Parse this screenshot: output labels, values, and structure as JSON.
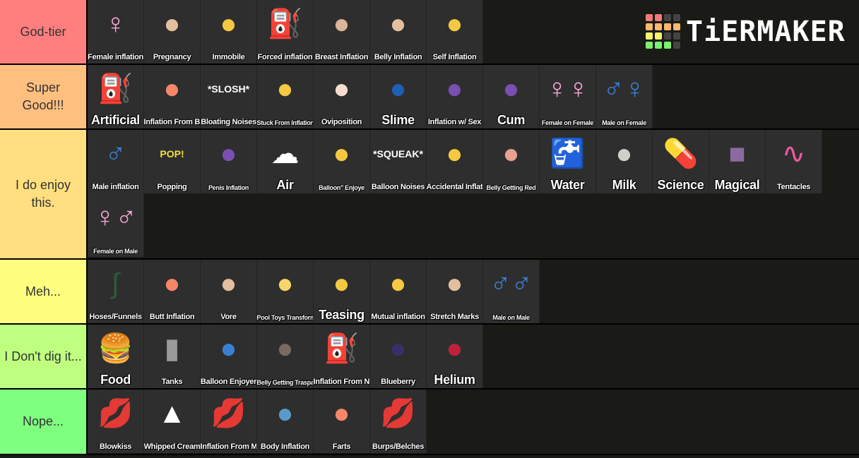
{
  "logo": {
    "text": "TiERMAKER",
    "grid_colors": [
      "#f27a7a",
      "#f27a7a",
      "#444444",
      "#444444",
      "#fdb96f",
      "#fdb96f",
      "#fdb96f",
      "#fdb96f",
      "#f7f26c",
      "#f7f26c",
      "#444444",
      "#444444",
      "#7cf06f",
      "#7cf06f",
      "#7cf06f",
      "#444444"
    ]
  },
  "tiers": [
    {
      "label": "God-tier",
      "color": "#ff7f7f",
      "items": [
        {
          "caption": "Female inflation",
          "icon": "female-symbol-icon",
          "glyph": "♀",
          "glyph_color": "#f7a6d8"
        },
        {
          "caption": "Pregnancy",
          "icon": "belly-icon",
          "glyph": "●",
          "glyph_color": "#e3bfa0"
        },
        {
          "caption": "Immobile",
          "icon": "face-emoji-icon",
          "glyph": "●",
          "glyph_color": "#f5c842"
        },
        {
          "caption": "Forced inflation",
          "icon": "pump-icon",
          "glyph": "⛽",
          "glyph_color": "#4a1010"
        },
        {
          "caption": "Breast Inflation",
          "icon": "breast-icon",
          "glyph": "●",
          "glyph_color": "#d9b59a"
        },
        {
          "caption": "Belly Inflation",
          "icon": "belly-icon",
          "glyph": "●",
          "glyph_color": "#e3bfa0"
        },
        {
          "caption": "Self Inflation",
          "icon": "face-emoji-icon",
          "glyph": "●",
          "glyph_color": "#f5c842"
        }
      ]
    },
    {
      "label": "Super Good!!!",
      "color": "#ffbf7f",
      "items": [
        {
          "caption": "Artificial",
          "icon": "pump-icon",
          "glyph": "⛽",
          "glyph_color": "#4a1010",
          "size": "big"
        },
        {
          "caption": "Inflation From Butt",
          "icon": "peach-icon",
          "glyph": "●",
          "glyph_color": "#f4876a"
        },
        {
          "caption": "Bloating Noises",
          "icon": "sound-text-icon",
          "glyph": "*SLOSH*",
          "glyph_color": "#ffffff"
        },
        {
          "caption": "Stuck From Inflation",
          "icon": "face-emoji-icon",
          "glyph": "●",
          "glyph_color": "#f5c842",
          "size": "small"
        },
        {
          "caption": "Oviposition",
          "icon": "egg-icon",
          "glyph": "●",
          "glyph_color": "#f7ddd0"
        },
        {
          "caption": "Slime",
          "icon": "slime-icon",
          "glyph": "●",
          "glyph_color": "#1e5fb3",
          "size": "big"
        },
        {
          "caption": "Inflation w/ Sex",
          "icon": "eggplant-icon",
          "glyph": "●",
          "glyph_color": "#7b4fb0"
        },
        {
          "caption": "Cum",
          "icon": "eggplant-icon",
          "glyph": "●",
          "glyph_color": "#7b4fb0",
          "size": "big"
        },
        {
          "caption": "Female on Female",
          "icon": "female-symbol-icon",
          "glyph": "♀♀",
          "glyph_color": "#f7a6d8",
          "size": "small"
        },
        {
          "caption": "Male on Female",
          "icon": "male-female-icon",
          "glyph": "♂♀",
          "glyph_color": "#3b7fd4",
          "size": "small"
        }
      ]
    },
    {
      "label": "I do enjoy this.",
      "color": "#ffdf7f",
      "items": [
        {
          "caption": "Male inflation",
          "icon": "male-symbol-icon",
          "glyph": "♂",
          "glyph_color": "#3b7fd4"
        },
        {
          "caption": "Popping",
          "icon": "pop-burst-icon",
          "glyph": "POP!",
          "glyph_color": "#f2e03a"
        },
        {
          "caption": "Penis Inflation",
          "icon": "eggplant-icon",
          "glyph": "●",
          "glyph_color": "#7b4fb0",
          "size": "small"
        },
        {
          "caption": "Air",
          "icon": "air-puff-icon",
          "glyph": "☁",
          "glyph_color": "#ffffff",
          "size": "big"
        },
        {
          "caption": "Balloon\" Enjoye",
          "icon": "face-emoji-icon",
          "glyph": "●",
          "glyph_color": "#f5c842",
          "size": "small"
        },
        {
          "caption": "Balloon Noises",
          "icon": "sound-text-icon",
          "glyph": "*SQUEAK*",
          "glyph_color": "#ffffff"
        },
        {
          "caption": "Accidental Inflation",
          "icon": "face-emoji-icon",
          "glyph": "●",
          "glyph_color": "#f5c842"
        },
        {
          "caption": "Belly Getting Red",
          "icon": "belly-icon",
          "glyph": "●",
          "glyph_color": "#e8a090",
          "size": "small"
        },
        {
          "caption": "Water",
          "icon": "water-tap-icon",
          "glyph": "🚰",
          "glyph_color": "#3b7fd4",
          "size": "big"
        },
        {
          "caption": "Milk",
          "icon": "cow-icon",
          "glyph": "●",
          "glyph_color": "#d0d0c8",
          "size": "big"
        },
        {
          "caption": "Science",
          "icon": "pill-icon",
          "glyph": "💊",
          "glyph_color": "#d03050",
          "size": "big"
        },
        {
          "caption": "Magical",
          "icon": "spellbook-icon",
          "glyph": "■",
          "glyph_color": "#8a6aa0",
          "size": "big"
        },
        {
          "caption": "Tentacles",
          "icon": "tentacle-icon",
          "glyph": "∿",
          "glyph_color": "#f05aa0"
        },
        {
          "caption": "Female on Male",
          "icon": "female-male-icon",
          "glyph": "♀♂",
          "glyph_color": "#f7a6d8",
          "size": "small"
        }
      ]
    },
    {
      "label": "Meh...",
      "color": "#ffff7f",
      "items": [
        {
          "caption": "Hoses/Funnels",
          "icon": "hose-icon",
          "glyph": "∫",
          "glyph_color": "#2e5a3a"
        },
        {
          "caption": "Butt Inflation",
          "icon": "peach-icon",
          "glyph": "●",
          "glyph_color": "#f4876a"
        },
        {
          "caption": "Vore",
          "icon": "belly-icon",
          "glyph": "●",
          "glyph_color": "#e3bfa0"
        },
        {
          "caption": "Pool Toys Transformation",
          "icon": "rubber-duck-icon",
          "glyph": "●",
          "glyph_color": "#f7d56a",
          "size": "small"
        },
        {
          "caption": "Teasing",
          "icon": "face-emoji-icon",
          "glyph": "●",
          "glyph_color": "#f5c842",
          "size": "big"
        },
        {
          "caption": "Mutual inflation",
          "icon": "face-emoji-icon",
          "glyph": "●",
          "glyph_color": "#f5c842"
        },
        {
          "caption": "Stretch Marks",
          "icon": "belly-icon",
          "glyph": "●",
          "glyph_color": "#e3bfa0"
        },
        {
          "caption": "Male on Male",
          "icon": "male-symbol-icon",
          "glyph": "♂♂",
          "glyph_color": "#3b7fd4",
          "size": "small"
        }
      ]
    },
    {
      "label": "I Don't dig it...",
      "color": "#bfff7f",
      "items": [
        {
          "caption": "Food",
          "icon": "burger-icon",
          "glyph": "🍔",
          "glyph_color": "#c8802a",
          "size": "big"
        },
        {
          "caption": "Tanks",
          "icon": "gas-tank-icon",
          "glyph": "▮",
          "glyph_color": "#9a9a9a"
        },
        {
          "caption": "Balloon Enjoyer",
          "icon": "balloon-icon",
          "glyph": "●",
          "glyph_color": "#3b7fd4"
        },
        {
          "caption": "Belly Getting Trasparent",
          "icon": "belly-icon",
          "glyph": "●",
          "glyph_color": "#7a6a60",
          "size": "small"
        },
        {
          "caption": "Inflation From Navel",
          "icon": "pump-icon",
          "glyph": "⛽",
          "glyph_color": "#4a1010"
        },
        {
          "caption": "Blueberry",
          "icon": "blueberry-icon",
          "glyph": "●",
          "glyph_color": "#3a2e6a"
        },
        {
          "caption": "Helium",
          "icon": "balloons-icon",
          "glyph": "●",
          "glyph_color": "#c0203a",
          "size": "big"
        }
      ]
    },
    {
      "label": "Nope...",
      "color": "#7fff7f",
      "items": [
        {
          "caption": "Blowkiss",
          "icon": "lips-icon",
          "glyph": "💋",
          "glyph_color": "#e8607a"
        },
        {
          "caption": "Whipped Cream",
          "icon": "whipped-cream-icon",
          "glyph": "▲",
          "glyph_color": "#ffffff"
        },
        {
          "caption": "Inflation From Mouth",
          "icon": "lips-pump-icon",
          "glyph": "💋",
          "glyph_color": "#e8607a"
        },
        {
          "caption": "Body Inflation",
          "icon": "body-icon",
          "glyph": "●",
          "glyph_color": "#5a9ac8"
        },
        {
          "caption": "Farts",
          "icon": "peach-icon",
          "glyph": "●",
          "glyph_color": "#f4876a"
        },
        {
          "caption": "Burps/Belches",
          "icon": "lips-icon",
          "glyph": "💋",
          "glyph_color": "#e8607a"
        }
      ]
    }
  ]
}
